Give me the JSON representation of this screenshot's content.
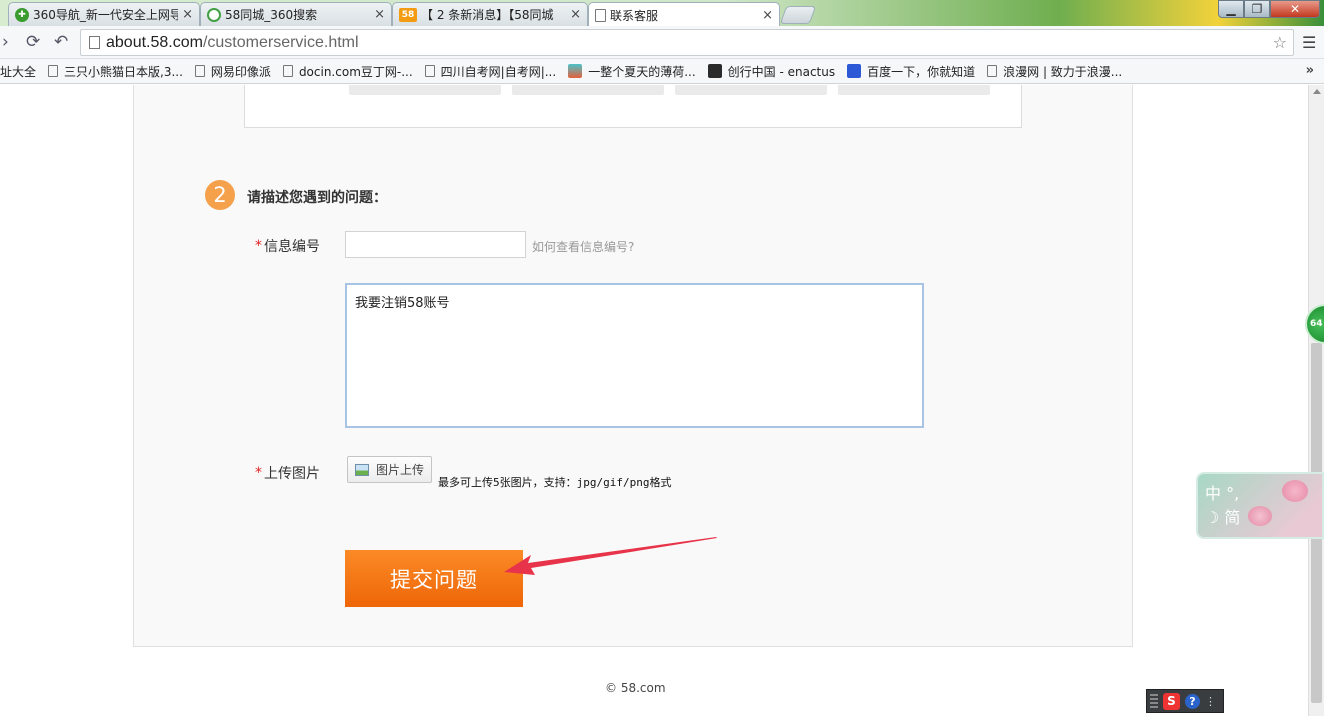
{
  "browser": {
    "tabs": [
      {
        "title": "360导航_新一代安全上网导",
        "icon_color": "#3a9b2f",
        "active": false
      },
      {
        "title": "58同城_360搜索",
        "icon_color": "#42a044",
        "active": false
      },
      {
        "title": "【 2 条新消息】【58同城",
        "icon_color": "#f39c12",
        "active": false
      },
      {
        "title": "联系客服",
        "icon_color": "#ffffff",
        "active": true
      }
    ],
    "tab_close_glyph": "×",
    "url_host": "about.58.com",
    "url_path": "/customerservice.html",
    "bookmarks": [
      {
        "label": "址大全",
        "icon": "none"
      },
      {
        "label": "三只小熊猫日本版,3...",
        "icon": "page"
      },
      {
        "label": "网易印像派",
        "icon": "page"
      },
      {
        "label": "docin.com豆丁网-...",
        "icon": "page"
      },
      {
        "label": "四川自考网|自考网|...",
        "icon": "page"
      },
      {
        "label": "一整个夏天的薄荷...",
        "icon": "color-teal"
      },
      {
        "label": "创行中国 - enactus",
        "icon": "color-dark"
      },
      {
        "label": "百度一下，你就知道",
        "icon": "color-blue"
      },
      {
        "label": "浪漫网 | 致力于浪漫...",
        "icon": "page"
      }
    ],
    "bookmarks_more": "»"
  },
  "form": {
    "step_number": "2",
    "step_title": "请描述您遇到的问题：",
    "required_mark": "*",
    "info_id_label": "信息编号",
    "info_id_value": "",
    "info_id_hint": "如何查看信息编号?",
    "description_value": "我要注销58账号",
    "upload_label": "上传图片",
    "upload_button": "图片上传",
    "upload_note": "最多可上传5张图片，支持：jpg/gif/png格式",
    "submit_button": "提交问题"
  },
  "footer": {
    "copyright": "© 58.com"
  },
  "overlays": {
    "side_bubble_text": "64",
    "ime_line1": "中 °,",
    "ime_line2": "☽ 简",
    "sogou_logo": "S",
    "sogou_help": "?",
    "annotation_arrow_color": "#e8344a",
    "accent_orange": "#f37012"
  }
}
